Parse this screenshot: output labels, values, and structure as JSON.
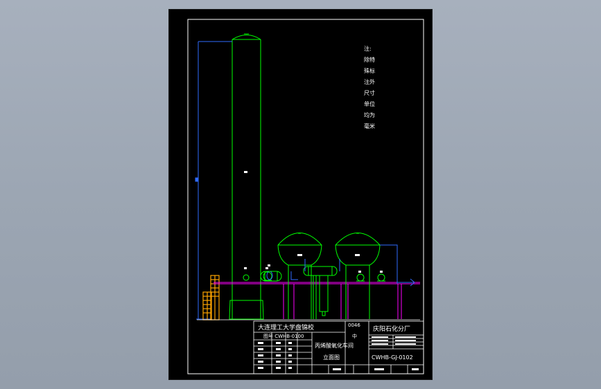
{
  "colors": {
    "background": "#9ea7b4",
    "sheet": "#000000",
    "frame": "#ffffff",
    "equipment": "#00ff00",
    "piping": "#ff00ff",
    "dimension": "#2f6bff",
    "ladder": "#ffa500",
    "text": "#ffffff"
  },
  "notes": {
    "heading": "注:",
    "lines": [
      "除特",
      "殊标",
      "注外",
      "尺寸",
      "单位",
      "均为",
      "毫米"
    ]
  },
  "title_block": {
    "school": "大连理工大学盘锦校",
    "drawing_no_left": "图号 CWHB-0100",
    "company": "庆阳石化分厂",
    "project_line1": "丙烯酸氧化车间",
    "project_line2": "立面图",
    "drawing_code": "CWHB-GJ-0102",
    "marks": [
      "0046",
      "中"
    ]
  }
}
